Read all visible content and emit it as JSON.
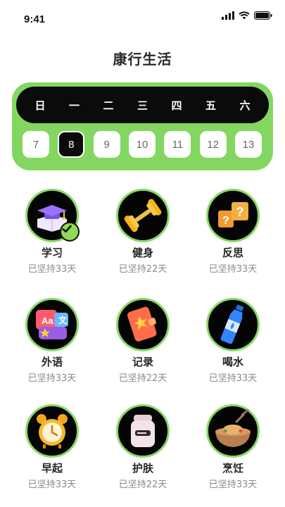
{
  "status_bar": {
    "time": "9:41"
  },
  "page": {
    "title": "康行生活"
  },
  "calendar": {
    "weekdays": [
      "日",
      "一",
      "二",
      "三",
      "四",
      "五",
      "六"
    ],
    "dates": [
      "7",
      "8",
      "9",
      "10",
      "11",
      "12",
      "13"
    ],
    "selected_date": "8"
  },
  "habits": [
    {
      "name": "学习",
      "streak": "已坚持33天",
      "icon": "graduation-book-icon",
      "completed": true
    },
    {
      "name": "健身",
      "streak": "已坚持22天",
      "icon": "dumbbell-icon",
      "completed": false
    },
    {
      "name": "反思",
      "streak": "已坚持33天",
      "icon": "question-cubes-icon",
      "completed": false
    },
    {
      "name": "外语",
      "streak": "已坚持33天",
      "icon": "language-cards-icon",
      "completed": false
    },
    {
      "name": "记录",
      "streak": "已坚持22天",
      "icon": "notebook-icon",
      "completed": false
    },
    {
      "name": "喝水",
      "streak": "已坚持33天",
      "icon": "water-bottle-icon",
      "completed": false
    },
    {
      "name": "早起",
      "streak": "已坚持33天",
      "icon": "alarm-clock-icon",
      "completed": false
    },
    {
      "name": "护肤",
      "streak": "已坚持22天",
      "icon": "skincare-jar-icon",
      "completed": false
    },
    {
      "name": "烹饪",
      "streak": "已坚持33天",
      "icon": "cooking-pot-icon",
      "completed": false
    }
  ],
  "colors": {
    "accent_green": "#83d660",
    "dark": "#0b0b0b"
  }
}
